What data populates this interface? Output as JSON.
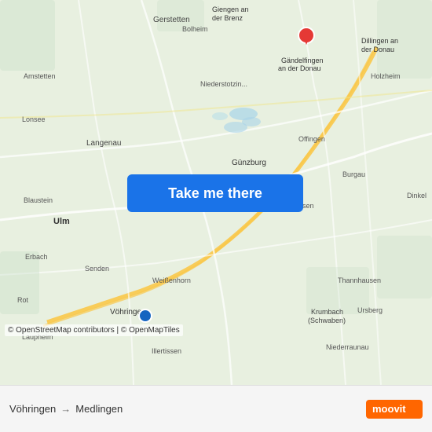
{
  "map": {
    "background_color": "#e8f0e8",
    "center_lat": 48.35,
    "center_lng": 10.15
  },
  "button": {
    "label": "Take me there"
  },
  "footer": {
    "from": "Vöhringen",
    "to": "Medlingen",
    "arrow": "→",
    "copyright": "© OpenStreetMap contributors | © OpenMapTiles"
  },
  "moovit": {
    "logo_text": "moovit"
  },
  "destination_pin": {
    "color": "#e53935"
  },
  "origin_pin": {
    "color": "#1565c0"
  }
}
